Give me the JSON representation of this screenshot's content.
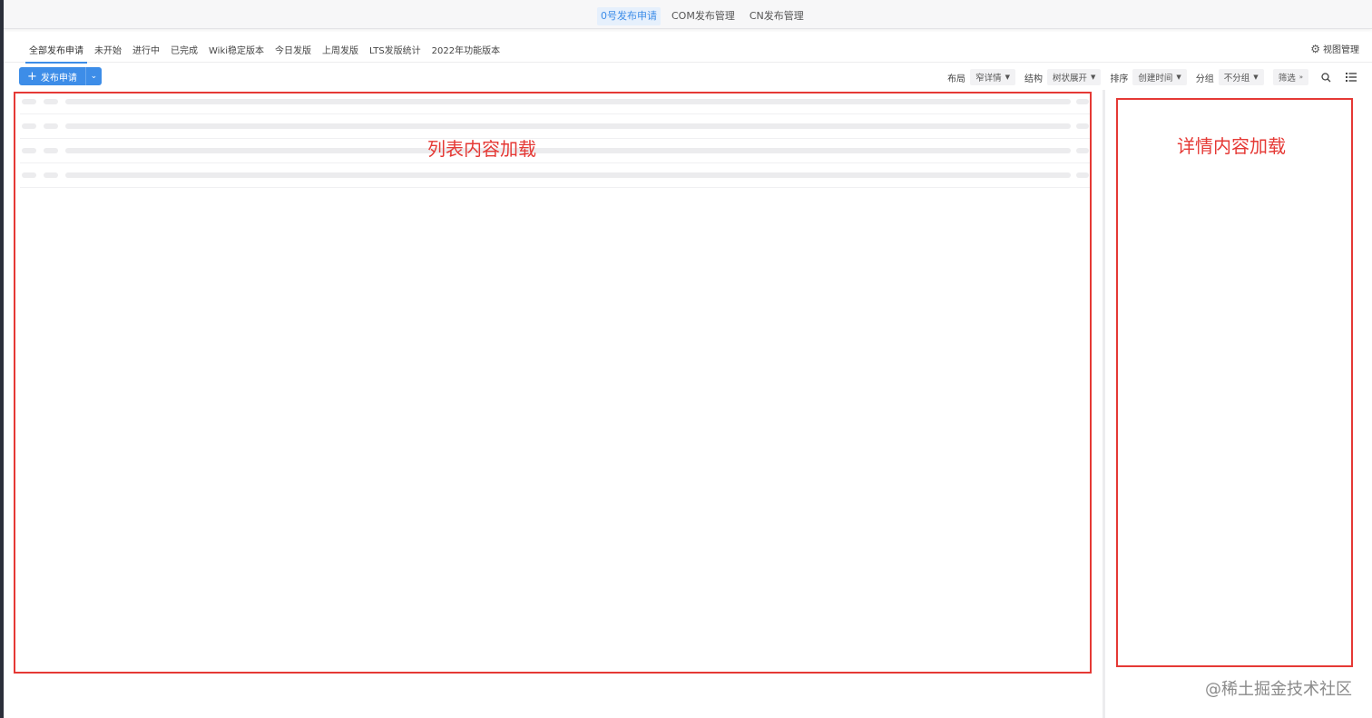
{
  "top_nav": {
    "items": [
      {
        "label": "0号发布申请",
        "active": true
      },
      {
        "label": "COM发布管理",
        "active": false
      },
      {
        "label": "CN发布管理",
        "active": false
      }
    ]
  },
  "tabs": {
    "items": [
      "全部发布申请",
      "未开始",
      "进行中",
      "已完成",
      "Wiki稳定版本",
      "今日发版",
      "上周发版",
      "LTS发版统计",
      "2022年功能版本"
    ],
    "active_index": 0,
    "view_manage_label": "视图管理"
  },
  "toolbar": {
    "create_button_label": "发布申请",
    "layout": {
      "label": "布局",
      "value": "窄详情"
    },
    "structure": {
      "label": "结构",
      "value": "树状展开"
    },
    "sort": {
      "label": "排序",
      "value": "创建时间"
    },
    "group": {
      "label": "分组",
      "value": "不分组"
    },
    "filter": {
      "value": "筛选"
    }
  },
  "icons": {
    "gear": "gear-icon",
    "plus": "plus-icon",
    "chevron": "chevron-down-icon",
    "search": "search-icon",
    "list": "list-icon"
  },
  "annotations": {
    "list_label": "列表内容加载",
    "detail_label": "详情内容加载",
    "color": "#e53935"
  },
  "watermark": "@稀土掘金技术社区",
  "colors": {
    "accent": "#3d8de8",
    "annotation_red": "#e53935"
  }
}
